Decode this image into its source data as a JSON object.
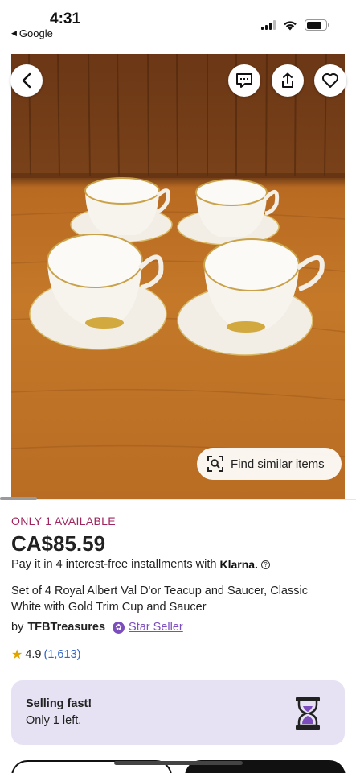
{
  "status_bar": {
    "time": "4:31",
    "back_app": "Google",
    "icons": [
      "signal-icon",
      "wifi-icon",
      "battery-icon"
    ]
  },
  "hero": {
    "toolbar_icons": [
      "back-arrow-icon",
      "message-icon",
      "share-icon",
      "heart-icon"
    ],
    "find_similar_label": "Find similar items",
    "find_similar_icon": "visual-search-icon"
  },
  "listing": {
    "availability": "ONLY 1 AVAILABLE",
    "price": "CA$85.59",
    "installments_text": "Pay it in 4 interest-free installments with",
    "klarna_label": "Klarna.",
    "title": "Set of 4 Royal Albert Val D'or Teacup and Saucer, Classic White with Gold Trim Cup and Saucer",
    "seller_prefix": "by",
    "seller_name": "TFBTreasures",
    "star_seller_label": "Star Seller",
    "rating": "4.9",
    "review_count": "(1,613)"
  },
  "selling_card": {
    "title": "Selling fast!",
    "subtitle": "Only 1 left.",
    "icon": "hourglass-icon"
  },
  "colors": {
    "availability": "#a0255e",
    "star_seller": "#7c4dbc",
    "reviews_link": "#3665c3",
    "card_background": "#e6e2f3",
    "rating_star": "#e0a400"
  }
}
